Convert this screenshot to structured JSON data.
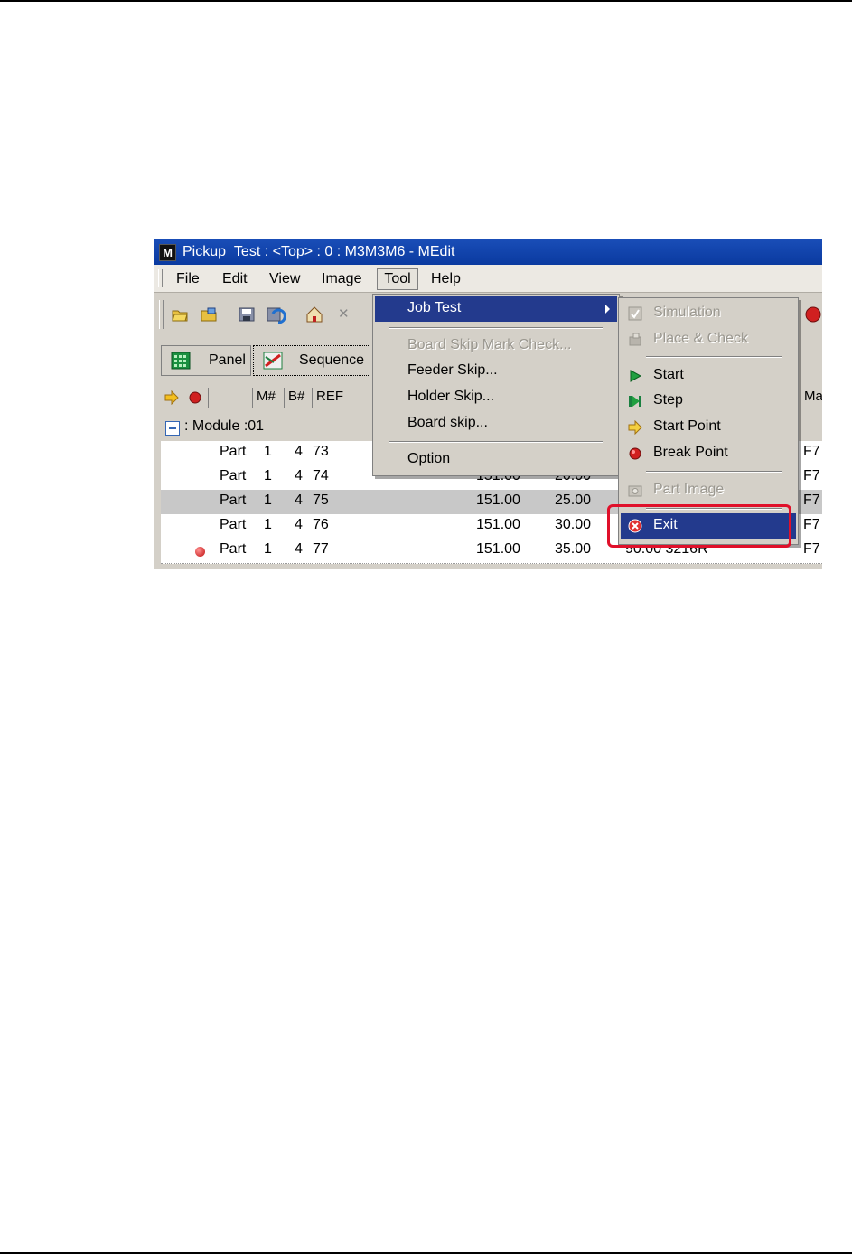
{
  "window": {
    "app_icon_letter": "M",
    "title": "Pickup_Test : <Top> : 0 : M3M3M6 - MEdit"
  },
  "menubar": {
    "file": "File",
    "edit": "Edit",
    "view": "View",
    "image": "Image",
    "tool": "Tool",
    "help": "Help"
  },
  "tabs": {
    "panel": "Panel",
    "sequence": "Sequence"
  },
  "columns": {
    "m": "M#",
    "b": "B#",
    "ref": "REF",
    "ma": "Ma"
  },
  "module_label": ": Module :01",
  "rows": [
    {
      "type": "Part",
      "m": "1",
      "b": "4",
      "ref": "73",
      "x": "",
      "y": "",
      "info": "",
      "ma": "F7"
    },
    {
      "type": "Part",
      "m": "1",
      "b": "4",
      "ref": "74",
      "x": "151.00",
      "y": "20.00",
      "info": "",
      "ma": "F7"
    },
    {
      "type": "Part",
      "m": "1",
      "b": "4",
      "ref": "75",
      "x": "151.00",
      "y": "25.00",
      "info": "",
      "ma": "F7"
    },
    {
      "type": "Part",
      "m": "1",
      "b": "4",
      "ref": "76",
      "x": "151.00",
      "y": "30.00",
      "info": "",
      "ma": "F7"
    },
    {
      "type": "Part",
      "m": "1",
      "b": "4",
      "ref": "77",
      "x": "151.00",
      "y": "35.00",
      "info": "90.00 3216R",
      "ma": "F7"
    }
  ],
  "tool_menu": {
    "job_test": "Job Test",
    "board_skip_mark_check": "Board Skip Mark Check...",
    "feeder_skip": "Feeder Skip...",
    "holder_skip": "Holder Skip...",
    "board_skip": "Board skip...",
    "option": "Option"
  },
  "job_test_menu": {
    "simulation": "Simulation",
    "place_check": "Place & Check",
    "start": "Start",
    "step": "Step",
    "start_point": "Start Point",
    "break_point": "Break Point",
    "part_image": "Part Image",
    "exit": "Exit"
  },
  "colors": {
    "menu_highlight": "#233a8d",
    "callout_red": "#e0102a",
    "titlebar": "#0a3aa0"
  }
}
